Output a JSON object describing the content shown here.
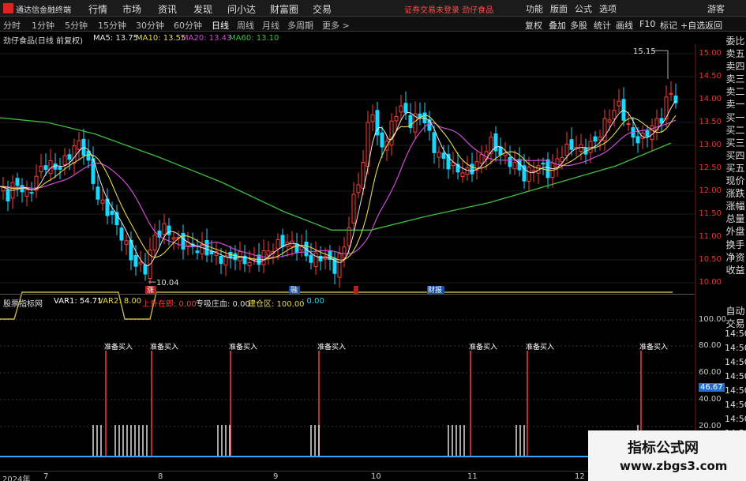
{
  "menubar": {
    "app_title": "通达信金融终端",
    "items": [
      "行情",
      "市场",
      "资讯",
      "发现",
      "问小达",
      "财富圈",
      "交易"
    ],
    "alert": "证券交易未登录  劲仔食品",
    "right": [
      "功能",
      "版面",
      "公式",
      "选项"
    ],
    "user": "游客"
  },
  "toolbar": {
    "periods": [
      "分时",
      "1分钟",
      "5分钟",
      "15分钟",
      "30分钟",
      "60分钟",
      "日线",
      "周线",
      "月线",
      "多周期",
      "更多 >"
    ],
    "active_period": "日线",
    "right": [
      "复权",
      "叠加",
      "多股",
      "统计",
      "画线",
      "F10",
      "标记",
      "+自选",
      "返回"
    ]
  },
  "kline": {
    "stock": "劲仔食品(日线 前复权)",
    "ma5": "MA5: 13.75",
    "ma10": "MA10: 13.55",
    "ma20": "MA20: 13.43",
    "ma60": "MA60: 13.10",
    "high_label": "15.15",
    "low_label": "10.04",
    "markers": [
      "涨",
      "融",
      "财报"
    ],
    "price_ticks": [
      "15.00",
      "14.50",
      "14.00",
      "13.50",
      "13.00",
      "12.50",
      "12.00",
      "11.50",
      "11.00",
      "10.50",
      "10.00"
    ]
  },
  "right_panel": [
    "委比",
    "卖五",
    "卖四",
    "卖三",
    "卖二",
    "卖一",
    "买一",
    "买二",
    "买三",
    "买四",
    "买五",
    "现价",
    "涨跌",
    "涨幅",
    "总量",
    "外盘",
    "换手",
    "净资",
    "收益"
  ],
  "right_panel2": [
    "自动",
    "交易"
  ],
  "indicator": {
    "name": "股票指标网",
    "var1": "VAR1: 54.71",
    "var2": "VAR2: 8.00",
    "rise": "上升在即: 0.00",
    "zhuang": "专吸庄血: 0.00",
    "jiancang": "建仓区: 100.00",
    "extra": ": 0.00",
    "signal_label": "准备买入",
    "ticks": [
      "100.00",
      "80.00",
      "60.00",
      "40.00",
      "20.00"
    ],
    "current": "46.67",
    "times": [
      "14:50",
      "14:50",
      "14:50",
      "14:50",
      "14:50",
      "14:50",
      "14:50",
      "14:50",
      "14:50"
    ]
  },
  "timeaxis": [
    "2024年",
    "7",
    "8",
    "9",
    "10",
    "11",
    "12"
  ],
  "watermark": {
    "line1": "指标公式网",
    "line2": "www.zbgs3.com"
  },
  "colors": {
    "up": "#ff3b3b",
    "down": "#18d8ff",
    "ma5": "#e8e8e8",
    "ma10": "#e6d94a",
    "ma20": "#d04cd8",
    "ma60": "#3fbf3f"
  }
}
